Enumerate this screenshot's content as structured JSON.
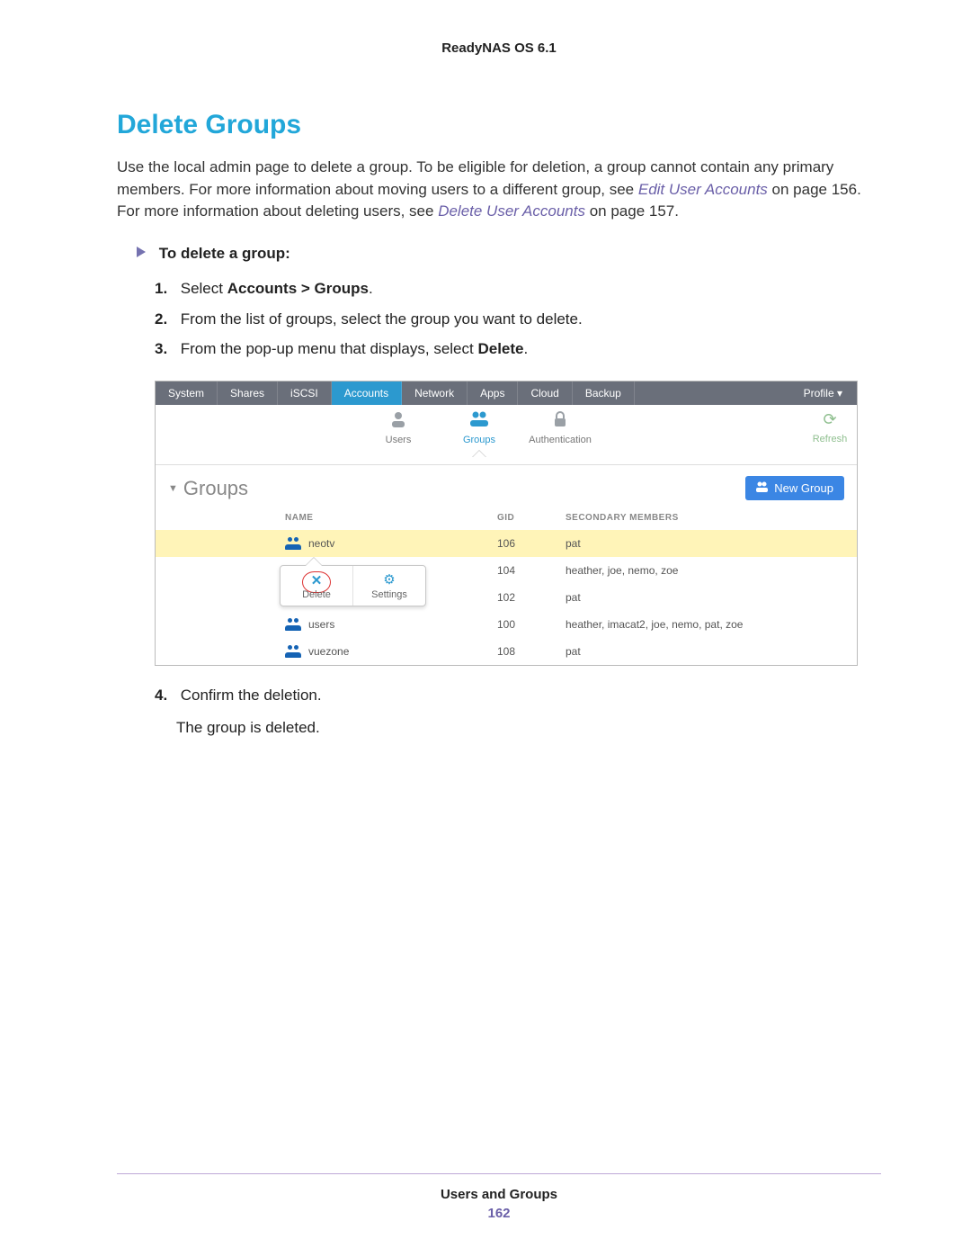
{
  "doc_header": "ReadyNAS OS 6.1",
  "heading": "Delete Groups",
  "intro_1": "Use the local admin page to delete a group. To be eligible for deletion, a group cannot contain any primary members. For more information about moving users to a different group, see ",
  "intro_link1": "Edit User Accounts",
  "intro_2": " on page 156. For more information about deleting users, see ",
  "intro_link2": "Delete User Accounts",
  "intro_3": " on page 157.",
  "to_heading": "To delete a group:",
  "steps": {
    "s1_a": "Select ",
    "s1_b": "Accounts > Groups",
    "s1_c": ".",
    "s2": "From the list of groups, select the group you want to delete.",
    "s3_a": "From the pop-up menu that displays, select ",
    "s3_b": "Delete",
    "s3_c": ".",
    "s4": "Confirm the deletion.",
    "s4_result": "The group is deleted."
  },
  "app": {
    "nav": {
      "system": "System",
      "shares": "Shares",
      "iscsi": "iSCSI",
      "accounts": "Accounts",
      "network": "Network",
      "apps": "Apps",
      "cloud": "Cloud",
      "backup": "Backup",
      "profile": "Profile ▾"
    },
    "sub": {
      "users": "Users",
      "groups": "Groups",
      "auth": "Authentication",
      "refresh": "Refresh"
    },
    "section_title": "Groups",
    "newgroup": "New Group",
    "cols": {
      "name": "NAME",
      "gid": "GID",
      "members": "SECONDARY MEMBERS"
    },
    "rows": [
      {
        "name": "neotv",
        "gid": "106",
        "members": "pat"
      },
      {
        "name": "",
        "gid": "104",
        "members": "heather, joe, nemo, zoe"
      },
      {
        "name": "",
        "gid": "102",
        "members": "pat"
      },
      {
        "name": "users",
        "gid": "100",
        "members": "heather, imacat2, joe, nemo, pat, zoe"
      },
      {
        "name": "vuezone",
        "gid": "108",
        "members": "pat"
      }
    ],
    "popup": {
      "delete": "Delete",
      "settings": "Settings"
    }
  },
  "footer": {
    "chapter": "Users and Groups",
    "page": "162"
  }
}
